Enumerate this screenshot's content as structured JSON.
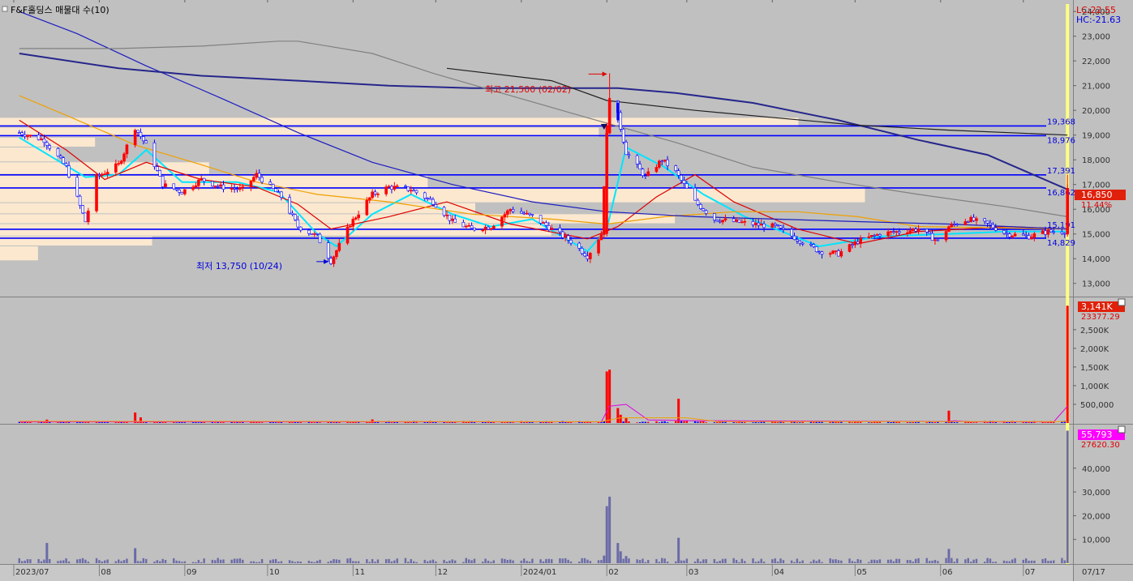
{
  "window": {
    "title": "F&F홀딩스 매물대 수(10)"
  },
  "colors": {
    "background": "#c0c0c0",
    "up": "#ff0000",
    "down": "#0000ff",
    "ma_cyan": "#00e5ff",
    "ma_red": "#e00000",
    "ma_orange": "#f0a000",
    "ma_blue": "#1c1cc0",
    "ma_navy": "#26268c",
    "ma_gray": "#808080",
    "ma_black": "#202020",
    "volume_profile": "#fbe8cf",
    "hline": "#0000ff",
    "current_marker": "#ffff80",
    "badge_red": "#e0200a",
    "badge_magenta": "#ff00ff",
    "volume_bar": "#6b6ba8"
  },
  "chart_data": [
    {
      "type": "line",
      "title": "F&F홀딩스 매물대 수(10)",
      "subtitle": "",
      "xlabel": "",
      "ylabel": "",
      "ylim": [
        12500,
        24300
      ],
      "yticks": [
        "13,000",
        "14,000",
        "15,000",
        "16,000",
        "17,000",
        "18,000",
        "19,000",
        "20,000",
        "21,000",
        "22,000",
        "23,000",
        "24,000"
      ],
      "ytick_values": [
        13000,
        14000,
        15000,
        16000,
        17000,
        18000,
        19000,
        20000,
        21000,
        22000,
        23000,
        24000
      ],
      "corner_labels": [
        "LC:22.55",
        "HC:-21.63"
      ],
      "x_tick_labels": [
        "2023/07",
        "08",
        "09",
        "10",
        "11",
        "12",
        "2024/01",
        "02",
        "03",
        "04",
        "05",
        "06",
        "07",
        "07/17"
      ],
      "price_path": [
        {
          "d": "2023-07-03",
          "c": 19100
        },
        {
          "d": "2023-07-12",
          "c": 18800
        },
        {
          "d": "2023-07-20",
          "c": 17700
        },
        {
          "d": "2023-07-27",
          "c": 15500
        },
        {
          "d": "2023-07-31",
          "c": 17300
        },
        {
          "d": "2023-08-08",
          "c": 17800
        },
        {
          "d": "2023-08-14",
          "c": 19300
        },
        {
          "d": "2023-08-18",
          "c": 18600
        },
        {
          "d": "2023-08-24",
          "c": 17000
        },
        {
          "d": "2023-08-31",
          "c": 16700
        },
        {
          "d": "2023-09-07",
          "c": 17200
        },
        {
          "d": "2023-09-14",
          "c": 16900
        },
        {
          "d": "2023-09-22",
          "c": 16800
        },
        {
          "d": "2023-09-27",
          "c": 17400
        },
        {
          "d": "2023-10-06",
          "c": 16500
        },
        {
          "d": "2023-10-12",
          "c": 15300
        },
        {
          "d": "2023-10-19",
          "c": 14900
        },
        {
          "d": "2023-10-24",
          "c": 13900
        },
        {
          "d": "2023-10-31",
          "c": 15400
        },
        {
          "d": "2023-11-08",
          "c": 16600
        },
        {
          "d": "2023-11-14",
          "c": 16900
        },
        {
          "d": "2023-11-22",
          "c": 16800
        },
        {
          "d": "2023-11-30",
          "c": 16300
        },
        {
          "d": "2023-12-07",
          "c": 15500
        },
        {
          "d": "2023-12-14",
          "c": 15200
        },
        {
          "d": "2023-12-21",
          "c": 15300
        },
        {
          "d": "2023-12-28",
          "c": 16000
        },
        {
          "d": "2024-01-05",
          "c": 15700
        },
        {
          "d": "2024-01-12",
          "c": 15200
        },
        {
          "d": "2024-01-19",
          "c": 14700
        },
        {
          "d": "2024-01-25",
          "c": 14100
        },
        {
          "d": "2024-01-30",
          "c": 15000
        },
        {
          "d": "2024-02-01",
          "c": 19000
        },
        {
          "d": "2024-02-02",
          "c": 20500
        },
        {
          "d": "2024-02-05",
          "c": 19800
        },
        {
          "d": "2024-02-08",
          "c": 18300
        },
        {
          "d": "2024-02-15",
          "c": 17300
        },
        {
          "d": "2024-02-21",
          "c": 18000
        },
        {
          "d": "2024-02-26",
          "c": 17500
        },
        {
          "d": "2024-03-04",
          "c": 16300
        },
        {
          "d": "2024-03-11",
          "c": 15600
        },
        {
          "d": "2024-03-18",
          "c": 15500
        },
        {
          "d": "2024-03-25",
          "c": 15400
        },
        {
          "d": "2024-04-02",
          "c": 15300
        },
        {
          "d": "2024-04-10",
          "c": 14800
        },
        {
          "d": "2024-04-18",
          "c": 14300
        },
        {
          "d": "2024-04-25",
          "c": 14200
        },
        {
          "d": "2024-05-02",
          "c": 14700
        },
        {
          "d": "2024-05-10",
          "c": 15000
        },
        {
          "d": "2024-05-17",
          "c": 15100
        },
        {
          "d": "2024-05-24",
          "c": 15200
        },
        {
          "d": "2024-05-31",
          "c": 14700
        },
        {
          "d": "2024-06-04",
          "c": 15300
        },
        {
          "d": "2024-06-11",
          "c": 15600
        },
        {
          "d": "2024-06-18",
          "c": 15400
        },
        {
          "d": "2024-06-25",
          "c": 15000
        },
        {
          "d": "2024-07-03",
          "c": 14900
        },
        {
          "d": "2024-07-10",
          "c": 15100
        },
        {
          "d": "2024-07-15",
          "c": 15100
        },
        {
          "d": "2024-07-16",
          "c": 15100
        },
        {
          "d": "2024-07-17",
          "c": 16850
        }
      ],
      "moving_averages": [
        {
          "color": "#00e5ff",
          "points": [
            [
              "2023-07-03",
              18900
            ],
            [
              "2023-07-27",
              17300
            ],
            [
              "2023-08-08",
              17400
            ],
            [
              "2023-08-18",
              18400
            ],
            [
              "2023-08-31",
              17100
            ],
            [
              "2023-09-20",
              17100
            ],
            [
              "2023-10-05",
              16700
            ],
            [
              "2023-10-19",
              15000
            ],
            [
              "2023-10-26",
              14500
            ],
            [
              "2023-11-08",
              15800
            ],
            [
              "2023-11-22",
              16600
            ],
            [
              "2023-12-07",
              15800
            ],
            [
              "2023-12-21",
              15300
            ],
            [
              "2024-01-05",
              15600
            ],
            [
              "2024-01-25",
              14300
            ],
            [
              "2024-02-01",
              15200
            ],
            [
              "2024-02-08",
              18500
            ],
            [
              "2024-02-22",
              17700
            ],
            [
              "2024-03-07",
              16600
            ],
            [
              "2024-03-22",
              15700
            ],
            [
              "2024-04-18",
              14500
            ],
            [
              "2024-05-10",
              14900
            ],
            [
              "2024-06-04",
              15000
            ],
            [
              "2024-06-25",
              15100
            ],
            [
              "2024-07-17",
              15100
            ]
          ]
        },
        {
          "color": "#e00000",
          "points": [
            [
              "2023-07-03",
              19600
            ],
            [
              "2023-07-20",
              18400
            ],
            [
              "2023-08-03",
              17200
            ],
            [
              "2023-08-18",
              17900
            ],
            [
              "2023-09-07",
              17200
            ],
            [
              "2023-09-27",
              16900
            ],
            [
              "2023-10-12",
              16200
            ],
            [
              "2023-10-24",
              15200
            ],
            [
              "2023-11-14",
              15700
            ],
            [
              "2023-12-05",
              16300
            ],
            [
              "2023-12-28",
              15400
            ],
            [
              "2024-01-25",
              14800
            ],
            [
              "2024-02-05",
              15300
            ],
            [
              "2024-02-19",
              16500
            ],
            [
              "2024-03-04",
              17400
            ],
            [
              "2024-03-18",
              16300
            ],
            [
              "2024-04-10",
              15200
            ],
            [
              "2024-05-02",
              14600
            ],
            [
              "2024-05-24",
              15100
            ],
            [
              "2024-06-25",
              15300
            ],
            [
              "2024-07-17",
              15200
            ]
          ]
        },
        {
          "color": "#f0a000",
          "points": [
            [
              "2023-07-03",
              20600
            ],
            [
              "2023-07-20",
              19800
            ],
            [
              "2023-08-14",
              18600
            ],
            [
              "2023-09-07",
              17800
            ],
            [
              "2023-09-27",
              17100
            ],
            [
              "2023-10-19",
              16600
            ],
            [
              "2023-11-14",
              16300
            ],
            [
              "2023-12-14",
              15800
            ],
            [
              "2024-01-12",
              15600
            ],
            [
              "2024-02-01",
              15400
            ],
            [
              "2024-02-22",
              15700
            ],
            [
              "2024-03-18",
              15900
            ],
            [
              "2024-04-10",
              15900
            ],
            [
              "2024-05-02",
              15700
            ],
            [
              "2024-05-24",
              15300
            ],
            [
              "2024-07-17",
              15200
            ]
          ]
        },
        {
          "color": "#1c1cc0",
          "points": [
            [
              "2023-07-03",
              24000
            ],
            [
              "2023-07-24",
              23100
            ],
            [
              "2023-08-18",
              21800
            ],
            [
              "2023-09-14",
              20500
            ],
            [
              "2023-10-12",
              19100
            ],
            [
              "2023-11-08",
              17900
            ],
            [
              "2023-12-07",
              17000
            ],
            [
              "2024-01-05",
              16300
            ],
            [
              "2024-02-01",
              15900
            ],
            [
              "2024-03-04",
              15700
            ],
            [
              "2024-04-02",
              15600
            ],
            [
              "2024-05-02",
              15500
            ],
            [
              "2024-06-04",
              15400
            ],
            [
              "2024-07-17",
              15200
            ]
          ]
        },
        {
          "color": "#26268c",
          "points": [
            [
              "2023-07-03",
              22300
            ],
            [
              "2023-08-08",
              21700
            ],
            [
              "2023-09-07",
              21400
            ],
            [
              "2023-10-12",
              21200
            ],
            [
              "2023-11-14",
              21000
            ],
            [
              "2023-12-14",
              20900
            ],
            [
              "2024-01-19",
              20900
            ],
            [
              "2024-02-05",
              20900
            ],
            [
              "2024-02-26",
              20700
            ],
            [
              "2024-03-25",
              20300
            ],
            [
              "2024-04-25",
              19600
            ],
            [
              "2024-05-24",
              18800
            ],
            [
              "2024-06-18",
              18200
            ],
            [
              "2024-07-17",
              16800
            ]
          ]
        },
        {
          "color": "#808080",
          "points": [
            [
              "2023-07-03",
              22500
            ],
            [
              "2023-08-08",
              22500
            ],
            [
              "2023-09-07",
              22600
            ],
            [
              "2023-10-05",
              22800
            ],
            [
              "2023-10-12",
              22800
            ],
            [
              "2023-11-08",
              22300
            ],
            [
              "2023-11-30",
              21500
            ],
            [
              "2023-12-28",
              20600
            ],
            [
              "2024-01-25",
              19700
            ],
            [
              "2024-02-26",
              18700
            ],
            [
              "2024-03-25",
              17700
            ],
            [
              "2024-04-25",
              17100
            ],
            [
              "2024-05-24",
              16600
            ],
            [
              "2024-06-25",
              16100
            ],
            [
              "2024-07-17",
              15700
            ]
          ]
        },
        {
          "color": "#202020",
          "points": [
            [
              "2023-12-05",
              21700
            ],
            [
              "2024-01-12",
              21200
            ],
            [
              "2024-02-01",
              20400
            ],
            [
              "2024-03-04",
              20000
            ],
            [
              "2024-04-02",
              19700
            ],
            [
              "2024-05-02",
              19400
            ],
            [
              "2024-06-04",
              19200
            ],
            [
              "2024-07-17",
              19000
            ]
          ]
        }
      ],
      "volume_profile": [
        {
          "lo": 19300,
          "hi": 19700,
          "len": 0.84
        },
        {
          "lo": 18900,
          "hi": 19300,
          "len": 0.63
        },
        {
          "lo": 18500,
          "hi": 18900,
          "len": 0.1
        },
        {
          "lo": 17900,
          "hi": 18500,
          "len": 0.06
        },
        {
          "lo": 17400,
          "hi": 17900,
          "len": 0.22
        },
        {
          "lo": 16850,
          "hi": 17400,
          "len": 0.45
        },
        {
          "lo": 16250,
          "hi": 16850,
          "len": 0.91
        },
        {
          "lo": 15800,
          "hi": 16250,
          "len": 0.5
        },
        {
          "lo": 15400,
          "hi": 15800,
          "len": 0.71
        },
        {
          "lo": 14900,
          "hi": 15400,
          "len": 0.58
        },
        {
          "lo": 14500,
          "hi": 14900,
          "len": 0.16
        },
        {
          "lo": 13900,
          "hi": 14500,
          "len": 0.04
        }
      ],
      "horizontal_levels": [
        {
          "value": 19368,
          "label": "19,368"
        },
        {
          "value": 18976,
          "label": "18,976"
        },
        {
          "value": 17391,
          "label": "17,391"
        },
        {
          "value": 16862,
          "label": "16,862"
        },
        {
          "value": 15191,
          "label": "15,191"
        },
        {
          "value": 14829,
          "label": "14,829"
        }
      ],
      "current_price_label": "16,850",
      "current_change_label": "11.44%",
      "annotations": [
        {
          "text": "최고 21,500 (02/02)",
          "date": "2024-02-02",
          "value": 21500
        },
        {
          "text": "최저 13,750 (10/24)",
          "date": "2023-10-24",
          "value": 13750
        }
      ]
    },
    {
      "type": "bar",
      "ylim": [
        0,
        3300000
      ],
      "yticks": [
        "500,000",
        "1,000K",
        "1,500K",
        "2,000K",
        "2,500K"
      ],
      "ytick_values": [
        500000,
        1000000,
        1500000,
        2000000,
        2500000
      ],
      "badge_label": "3,141K",
      "secondary_label": "23377.29",
      "bars": [
        {
          "d": "2023-07-13",
          "v": 90000
        },
        {
          "d": "2023-08-14",
          "v": 280000
        },
        {
          "d": "2023-08-16",
          "v": 150000
        },
        {
          "d": "2023-11-08",
          "v": 95000
        },
        {
          "d": "2024-02-01",
          "v": 1380000
        },
        {
          "d": "2024-02-02",
          "v": 1430000
        },
        {
          "d": "2024-02-05",
          "v": 400000
        },
        {
          "d": "2024-02-06",
          "v": 220000
        },
        {
          "d": "2024-02-08",
          "v": 140000
        },
        {
          "d": "2024-02-27",
          "v": 650000
        },
        {
          "d": "2024-06-04",
          "v": 330000
        },
        {
          "d": "2024-07-17",
          "v": 3141000
        }
      ]
    },
    {
      "type": "bar",
      "ylim": [
        0,
        58000
      ],
      "yticks": [
        "10,000",
        "20,000",
        "30,000",
        "40,000"
      ],
      "ytick_values": [
        10000,
        20000,
        30000,
        40000
      ],
      "badge_label": "55,793",
      "secondary_label": "27620.30",
      "bars": [
        {
          "d": "2023-07-13",
          "v": 8500
        },
        {
          "d": "2023-08-14",
          "v": 6300
        },
        {
          "d": "2024-01-31",
          "v": 3200
        },
        {
          "d": "2024-02-01",
          "v": 24000
        },
        {
          "d": "2024-02-02",
          "v": 28000
        },
        {
          "d": "2024-02-05",
          "v": 8500
        },
        {
          "d": "2024-02-06",
          "v": 5000
        },
        {
          "d": "2024-02-08",
          "v": 3000
        },
        {
          "d": "2024-02-27",
          "v": 10700
        },
        {
          "d": "2024-06-04",
          "v": 6000
        },
        {
          "d": "2024-07-17",
          "v": 55793
        }
      ]
    }
  ]
}
